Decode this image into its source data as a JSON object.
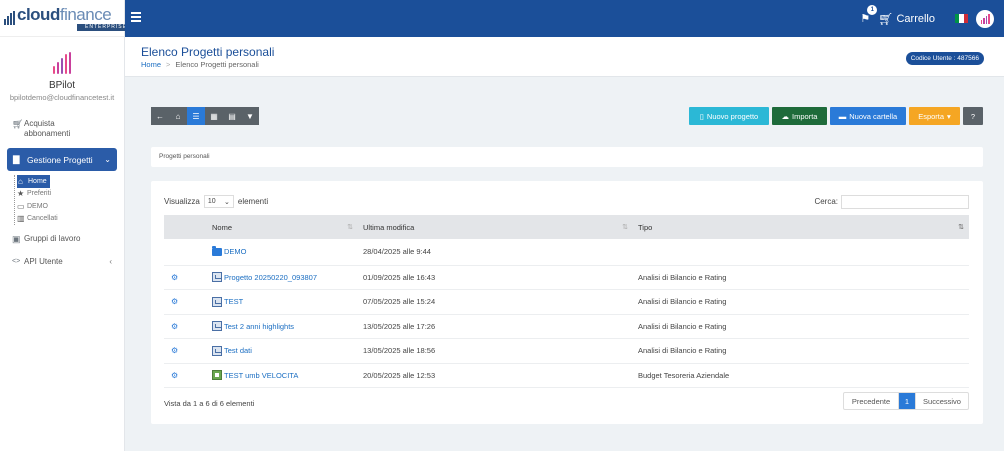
{
  "brand": {
    "name_part1": "cloud",
    "name_part2": "finance",
    "tagline": "ENTERPRISE"
  },
  "colors": {
    "primary": "#1b4f99",
    "active": "#2b5ca8",
    "link": "#1b6ec2",
    "cyan": "#2bb8d6",
    "green": "#1e6b3a",
    "blue": "#2a7ad8",
    "orange": "#f5a623",
    "grey": "#5a6268"
  },
  "topbar": {
    "notif_count": "1",
    "cart_label": "Carrello",
    "language_flag": "italy-flag",
    "menu_icon": "hamburger-icon"
  },
  "profile": {
    "name": "BPilot",
    "email": "bpilotdemo@cloudfinancetest.it"
  },
  "sidebar": {
    "purchase_line1": "Acquista",
    "purchase_line2": "abbonamenti",
    "projects": "Gestione Progetti",
    "tree": [
      {
        "label": "Home",
        "icon": "home-icon"
      },
      {
        "label": "Preferiti",
        "icon": "star-icon"
      },
      {
        "label": "DEMO",
        "icon": "folder-icon"
      },
      {
        "label": "Cancellati",
        "icon": "trash-icon"
      }
    ],
    "groups": "Gruppi di lavoro",
    "api": "API Utente"
  },
  "header": {
    "title": "Elenco Progetti personali",
    "breadcrumb_home": "Home",
    "breadcrumb_sep": ">",
    "breadcrumb_current": "Elenco Progetti personali",
    "user_code": "Codice Utente : 487566"
  },
  "toolbar": {
    "new_project": "Nuovo progetto",
    "import": "Importa",
    "new_folder": "Nuova cartella",
    "export": "Esporta",
    "help": "?"
  },
  "crumb_panel": "Progetti personali",
  "table": {
    "show_label": "Visualizza",
    "page_length": "10",
    "entries_label": "elementi",
    "search_label": "Cerca:",
    "headers": [
      "Nome",
      "Ultima modifica",
      "Tipo"
    ],
    "rows": [
      {
        "name": "DEMO",
        "modified": "28/04/2025 alle 9:44",
        "type": "",
        "kind": "folder"
      },
      {
        "name": "Progetto 20250220_093807",
        "modified": "01/09/2025 alle 16:43",
        "type": "Analisi di Bilancio e Rating",
        "kind": "analysis"
      },
      {
        "name": "TEST",
        "modified": "07/05/2025 alle 15:24",
        "type": "Analisi di Bilancio e Rating",
        "kind": "analysis"
      },
      {
        "name": "Test 2 anni highlights",
        "modified": "13/05/2025 alle 17:26",
        "type": "Analisi di Bilancio e Rating",
        "kind": "analysis"
      },
      {
        "name": "Test dati",
        "modified": "13/05/2025 alle 18:56",
        "type": "Analisi di Bilancio e Rating",
        "kind": "analysis"
      },
      {
        "name": "TEST umb VELOCITA",
        "modified": "20/05/2025 alle 12:53",
        "type": "Budget Tesoreria Aziendale",
        "kind": "budget"
      }
    ],
    "info": "Vista da 1 a 6 di 6 elementi",
    "prev": "Precedente",
    "current_page": "1",
    "next": "Successivo"
  }
}
